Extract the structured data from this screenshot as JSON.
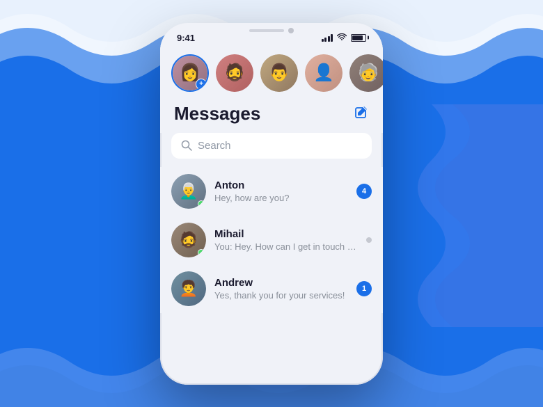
{
  "background": {
    "color": "#1a6fe8"
  },
  "phone": {
    "status_bar": {
      "time": "9:41",
      "signal": "signal",
      "wifi": "wifi",
      "battery": "battery"
    },
    "stories": [
      {
        "id": "story-self",
        "has_ring": true,
        "has_add": true,
        "emoji": "👩"
      },
      {
        "id": "story-1",
        "has_ring": false,
        "emoji": "🧔"
      },
      {
        "id": "story-2",
        "has_ring": false,
        "emoji": "👨"
      },
      {
        "id": "story-3",
        "has_ring": false,
        "emoji": "👤"
      },
      {
        "id": "story-4",
        "has_ring": false,
        "emoji": "🧓"
      }
    ],
    "messages_header": {
      "title": "Messages",
      "compose_label": "compose"
    },
    "search": {
      "placeholder": "Search"
    },
    "conversations": [
      {
        "id": "conv-anton",
        "name": "Anton",
        "preview": "Hey, how are you?",
        "unread_count": "4",
        "online": true,
        "avatar_class": "av-anton",
        "emoji": "👨‍🦳"
      },
      {
        "id": "conv-mihail",
        "name": "Mihail",
        "preview": "You: Hey. How can I get in touch with...",
        "unread_count": null,
        "online": true,
        "avatar_class": "av-mihail",
        "emoji": "🧔‍♂️"
      },
      {
        "id": "conv-andrew",
        "name": "Andrew",
        "preview": "Yes, thank you for your services!",
        "unread_count": "1",
        "online": false,
        "avatar_class": "av-andrew",
        "emoji": "🧑‍🦱"
      }
    ]
  }
}
